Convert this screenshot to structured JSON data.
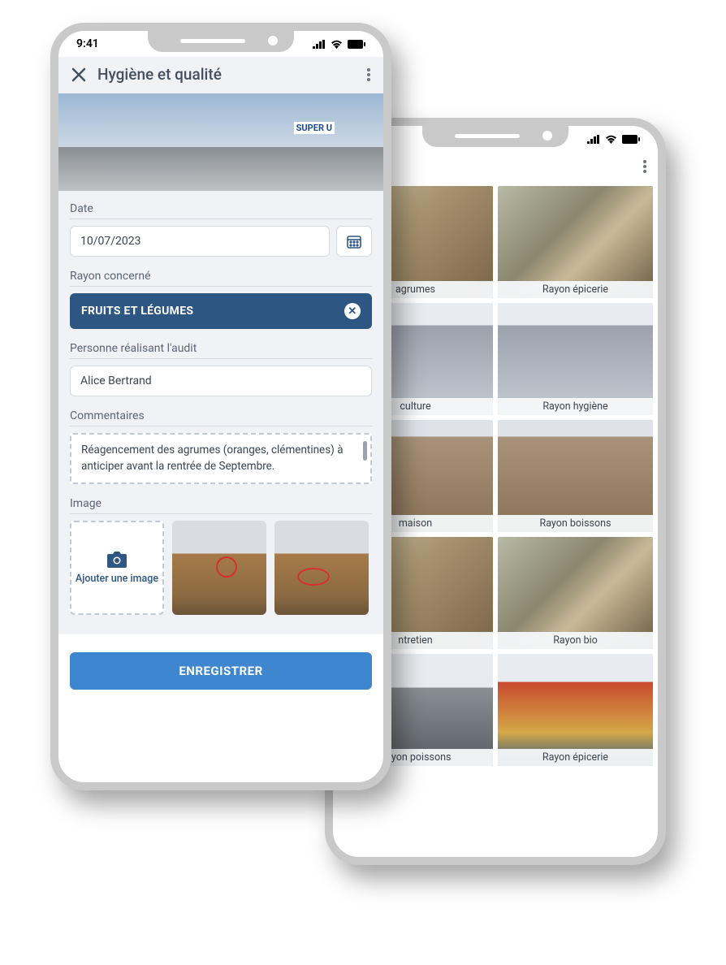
{
  "statusbar": {
    "time": "9:41"
  },
  "front": {
    "header": {
      "title": "Hygiène et qualité"
    },
    "form": {
      "date_label": "Date",
      "date_value": "10/07/2023",
      "rayon_label": "Rayon concerné",
      "rayon_value": "FRUITS ET LÉGUMES",
      "person_label": "Personne réalisant l'audit",
      "person_value": "Alice Bertrand",
      "comments_label": "Commentaires",
      "comments_value": "Réagencement des agrumes (oranges, clémentines) à anticiper avant la rentrée de Septembre.",
      "image_label": "Image",
      "add_image_label": "Ajouter une image",
      "save_label": "ENREGISTRER"
    }
  },
  "back": {
    "gallery": [
      {
        "label": "agrumes"
      },
      {
        "label": "Rayon épicerie"
      },
      {
        "label": "culture"
      },
      {
        "label": "Rayon hygiène"
      },
      {
        "label": "maison"
      },
      {
        "label": "Rayon boissons"
      },
      {
        "label": "ntretien"
      },
      {
        "label": "Rayon bio"
      },
      {
        "label": "Rayon poissons"
      },
      {
        "label": "Rayon épicerie"
      }
    ]
  }
}
